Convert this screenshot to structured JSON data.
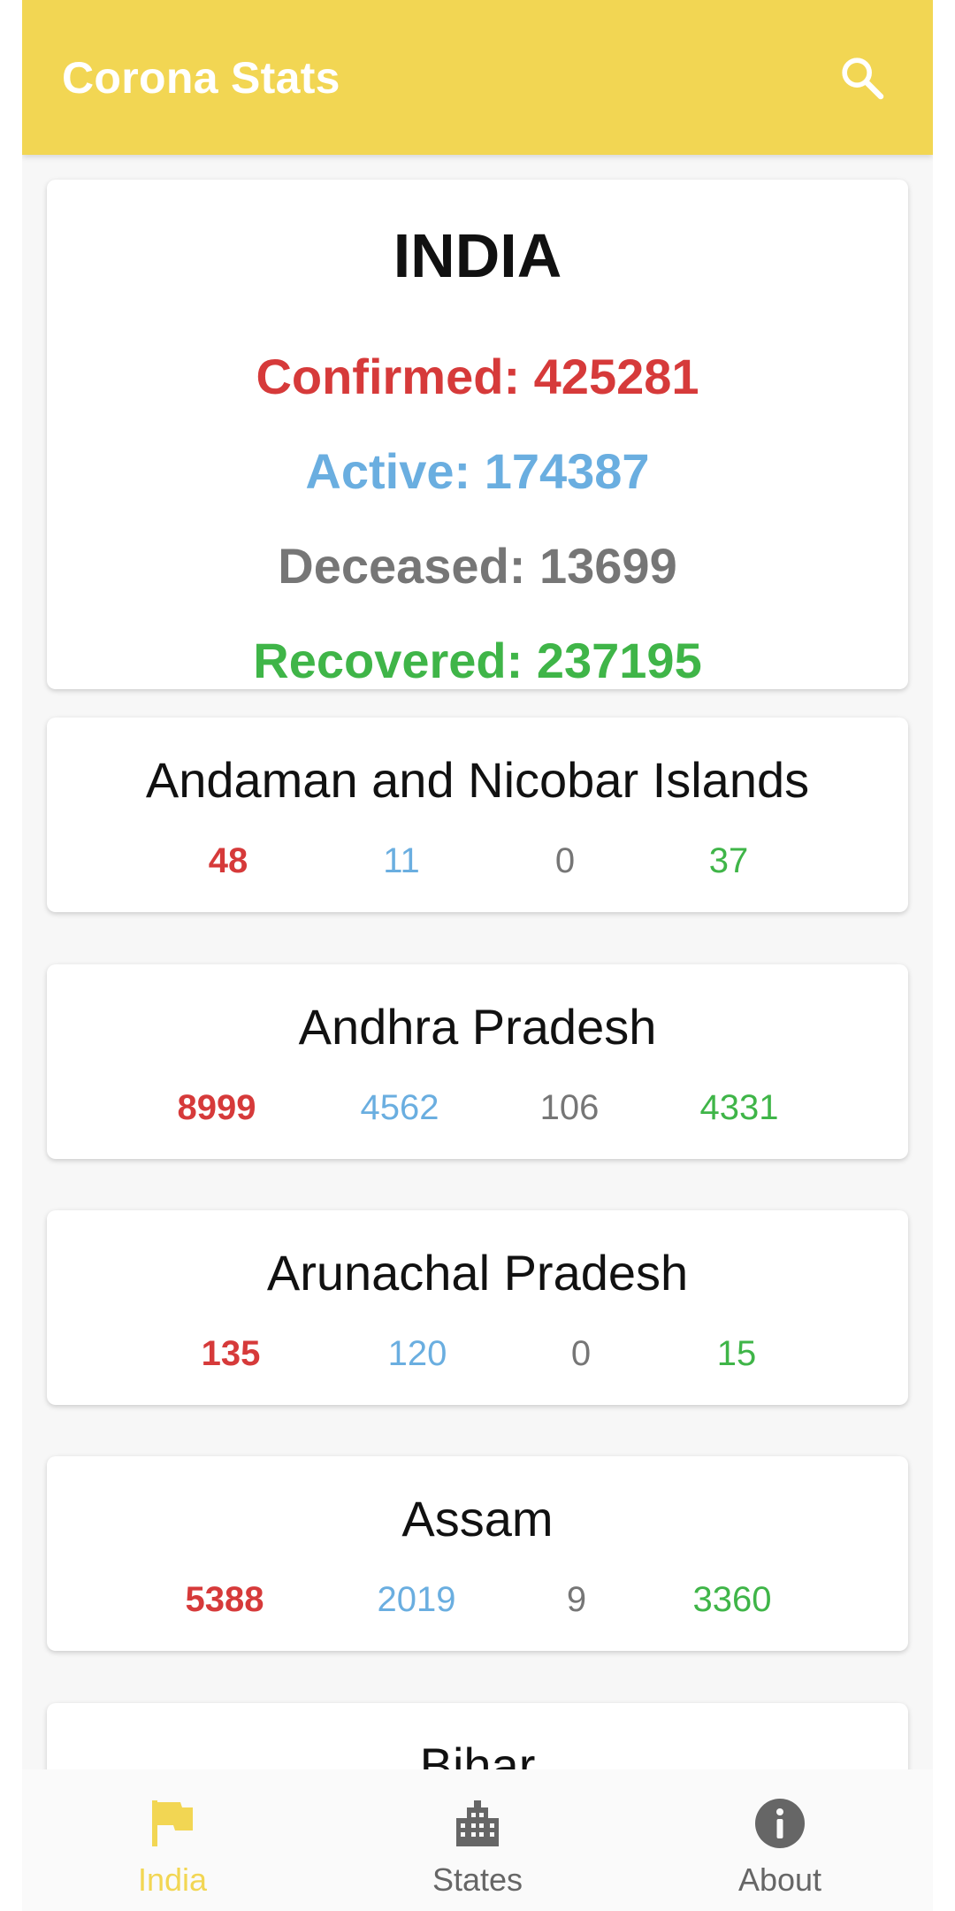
{
  "app_bar": {
    "title": "Corona Stats",
    "search_icon": "search-icon"
  },
  "summary": {
    "country": "INDIA",
    "confirmed": "Confirmed: 425281",
    "active": "Active: 174387",
    "deceased": "Deceased: 13699",
    "recovered": "Recovered: 237195"
  },
  "states": [
    {
      "name": "Andaman and Nicobar Islands",
      "confirmed": "48",
      "active": "11",
      "deceased": "0",
      "recovered": "37"
    },
    {
      "name": "Andhra Pradesh",
      "confirmed": "8999",
      "active": "4562",
      "deceased": "106",
      "recovered": "4331"
    },
    {
      "name": "Arunachal Pradesh",
      "confirmed": "135",
      "active": "120",
      "deceased": "0",
      "recovered": "15"
    },
    {
      "name": "Assam",
      "confirmed": "5388",
      "active": "2019",
      "deceased": "9",
      "recovered": "3360"
    },
    {
      "name": "Bihar"
    }
  ],
  "bottom_nav": {
    "items": [
      {
        "label": "India",
        "icon": "flag-icon",
        "active": true
      },
      {
        "label": "States",
        "icon": "city-icon",
        "active": false
      },
      {
        "label": "About",
        "icon": "info-icon",
        "active": false
      }
    ]
  },
  "colors": {
    "accent": "#f2d653",
    "confirmed": "#d63a3a",
    "active": "#6aaee0",
    "deceased": "#767676",
    "recovered": "#3fb548"
  }
}
